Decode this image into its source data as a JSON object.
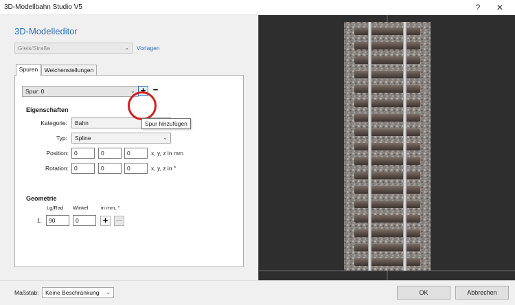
{
  "window": {
    "title": "3D-Modellbahn Studio V5",
    "help_glyph": "?",
    "close_glyph": "✕"
  },
  "editor": {
    "heading": "3D-Modelleditor",
    "category_combo": {
      "value": "Gleis/Straße"
    },
    "templates_link": "Vorlagen"
  },
  "tabs": [
    {
      "label": "Spuren",
      "active": true
    },
    {
      "label": "Weichenstellungen",
      "active": false
    }
  ],
  "spur": {
    "selector_value": "Spur: 0",
    "add_glyph": "+",
    "remove_glyph": "−",
    "tooltip": "Spur hinzufügen"
  },
  "properties": {
    "heading": "Eigenschaften",
    "kategorie_label": "Kategorie:",
    "kategorie_value": "Bahn",
    "typ_label": "Typ:",
    "typ_value": "Spline",
    "position_label": "Position:",
    "position_values": [
      "0",
      "0",
      "0"
    ],
    "position_unit": "x, y, z in mm",
    "rotation_label": "Rotation:",
    "rotation_values": [
      "0",
      "0",
      "0"
    ],
    "rotation_unit": "x, y, z in °"
  },
  "geometry": {
    "heading": "Geometrie",
    "col_length": "Lg/Rad",
    "col_angle": "Winkel",
    "col_unit": "in mm, °",
    "rows": [
      {
        "index": "1.",
        "length": "90",
        "angle": "0"
      }
    ],
    "add_glyph": "+",
    "remove_glyph": "—"
  },
  "footer": {
    "scale_label": "Maßstab:",
    "scale_value": "Keine Beschränkung",
    "ok_label": "OK",
    "cancel_label": "Abbrechen"
  },
  "colors": {
    "accent": "#2a6ebb",
    "highlight_circle": "#d41d1d",
    "viewport_bg": "#2e2e2e"
  }
}
